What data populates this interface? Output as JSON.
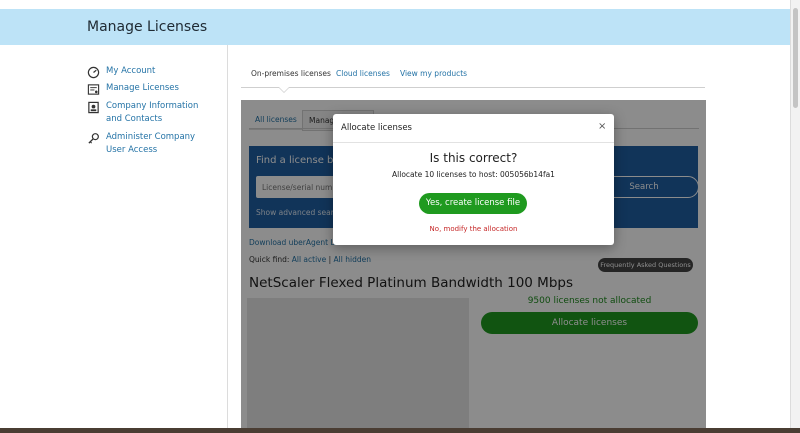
{
  "header": {
    "title": "Manage Licenses"
  },
  "sidebar": {
    "items": [
      {
        "label": "My Account",
        "icon": "gauge-icon"
      },
      {
        "label": "Manage Licenses",
        "icon": "license-icon"
      },
      {
        "label": "Company Information and Contacts",
        "icon": "company-icon"
      },
      {
        "label": "Administer Company User Access",
        "icon": "key-icon"
      }
    ]
  },
  "top_tabs": [
    {
      "label": "On-premises licenses",
      "active": true
    },
    {
      "label": "Cloud licenses",
      "active": false
    },
    {
      "label": "View my products",
      "active": false
    }
  ],
  "inner_tabs": [
    {
      "label": "All licenses",
      "active": false
    },
    {
      "label": "Manag",
      "active": true
    }
  ],
  "search": {
    "title": "Find a license by...",
    "placeholder": "License/serial numbe",
    "button_label": "Search",
    "advanced_label": "Show advanced search"
  },
  "download_link": "Download uberAgent Lic",
  "quick_find": {
    "label": "Quick find:",
    "all_active": "All active",
    "separator": "|",
    "all_hidden": "All hidden"
  },
  "faq_button": "Frequently Asked Questions ▾",
  "product": {
    "title": "NetScaler Flexed Platinum Bandwidth 100 Mbps",
    "not_allocated": "9500 licenses not allocated",
    "allocate_button": "Allocate licenses"
  },
  "modal": {
    "title": "Allocate licenses",
    "close": "×",
    "question": "Is this correct?",
    "description": "Allocate 10 licenses to host: 005056b14fa1",
    "confirm_button": "Yes, create license file",
    "modify_link": "No, modify the allocation"
  },
  "colors": {
    "header_bg": "#bde3f7",
    "link": "#2473a6",
    "search_panel": "#1f5fa3",
    "success": "#1f9a1f",
    "danger": "#c62828"
  }
}
